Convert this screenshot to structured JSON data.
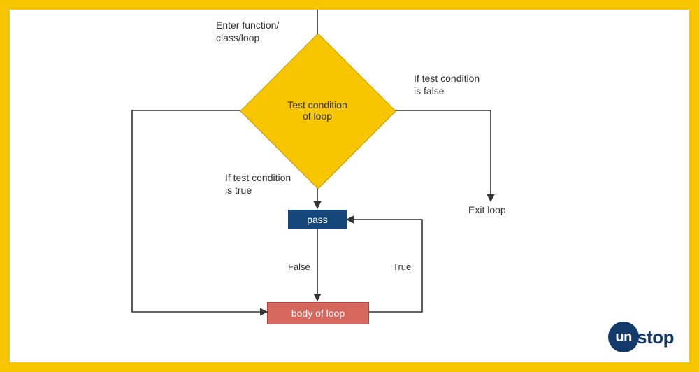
{
  "flow": {
    "entry_label_line1": "Enter function/",
    "entry_label_line2": "class/loop",
    "decision_line1": "Test condition",
    "decision_line2": "of loop",
    "cond_false_line1": "If test condition",
    "cond_false_line2": "is false",
    "cond_true_line1": "If test condition",
    "cond_true_line2": "is true",
    "exit_label": "Exit loop",
    "pass_label": "pass",
    "false_label": "False",
    "true_label": "True",
    "body_label": "body of loop"
  },
  "brand": {
    "circle_text": "un",
    "tail_text": "stop"
  }
}
